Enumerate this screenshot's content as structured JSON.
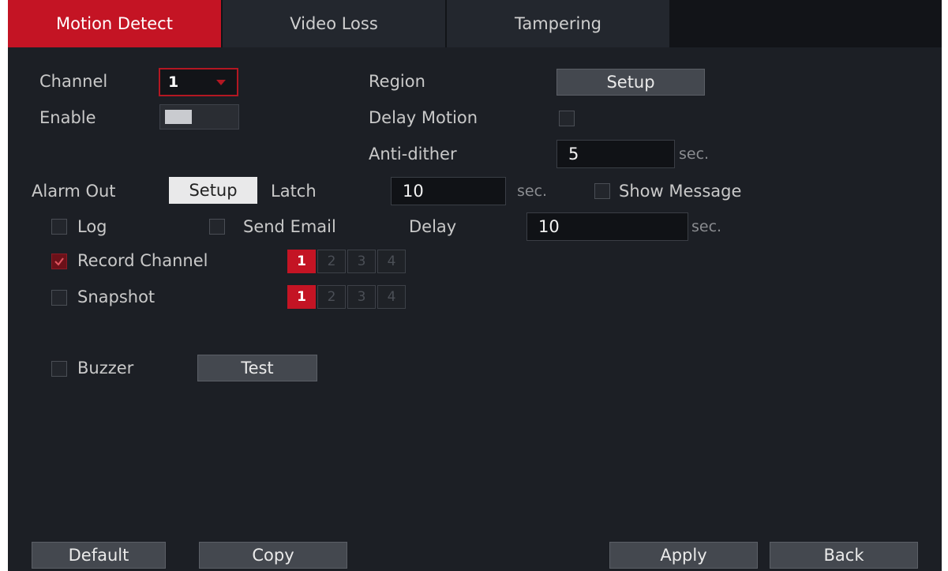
{
  "tabs": [
    {
      "label": "Motion Detect",
      "active": true
    },
    {
      "label": "Video Loss",
      "active": false
    },
    {
      "label": "Tampering",
      "active": false
    }
  ],
  "channel": {
    "label": "Channel",
    "value": "1"
  },
  "enable": {
    "label": "Enable",
    "on": false
  },
  "region": {
    "label": "Region",
    "button": "Setup"
  },
  "delay_motion": {
    "label": "Delay Motion",
    "checked": false
  },
  "anti_dither": {
    "label": "Anti-dither",
    "value": "5",
    "unit": "sec."
  },
  "alarm_out": {
    "label": "Alarm Out",
    "button": "Setup"
  },
  "latch": {
    "label": "Latch",
    "value": "10",
    "unit": "sec."
  },
  "show_message": {
    "label": "Show Message",
    "checked": false
  },
  "log": {
    "label": "Log",
    "checked": false
  },
  "send_email": {
    "label": "Send Email",
    "checked": false
  },
  "delay": {
    "label": "Delay",
    "value": "10",
    "unit": "sec."
  },
  "record_channel": {
    "label": "Record Channel",
    "checked": true,
    "channels": [
      "1",
      "2",
      "3",
      "4"
    ],
    "selected": [
      "1"
    ]
  },
  "snapshot": {
    "label": "Snapshot",
    "checked": false,
    "channels": [
      "1",
      "2",
      "3",
      "4"
    ],
    "selected": [
      "1"
    ]
  },
  "buzzer": {
    "label": "Buzzer",
    "checked": false,
    "button": "Test"
  },
  "footer": {
    "default": "Default",
    "copy": "Copy",
    "apply": "Apply",
    "back": "Back"
  },
  "colors": {
    "accent": "#c41424",
    "panel": "#1c1f25",
    "tab": "#23272e"
  }
}
